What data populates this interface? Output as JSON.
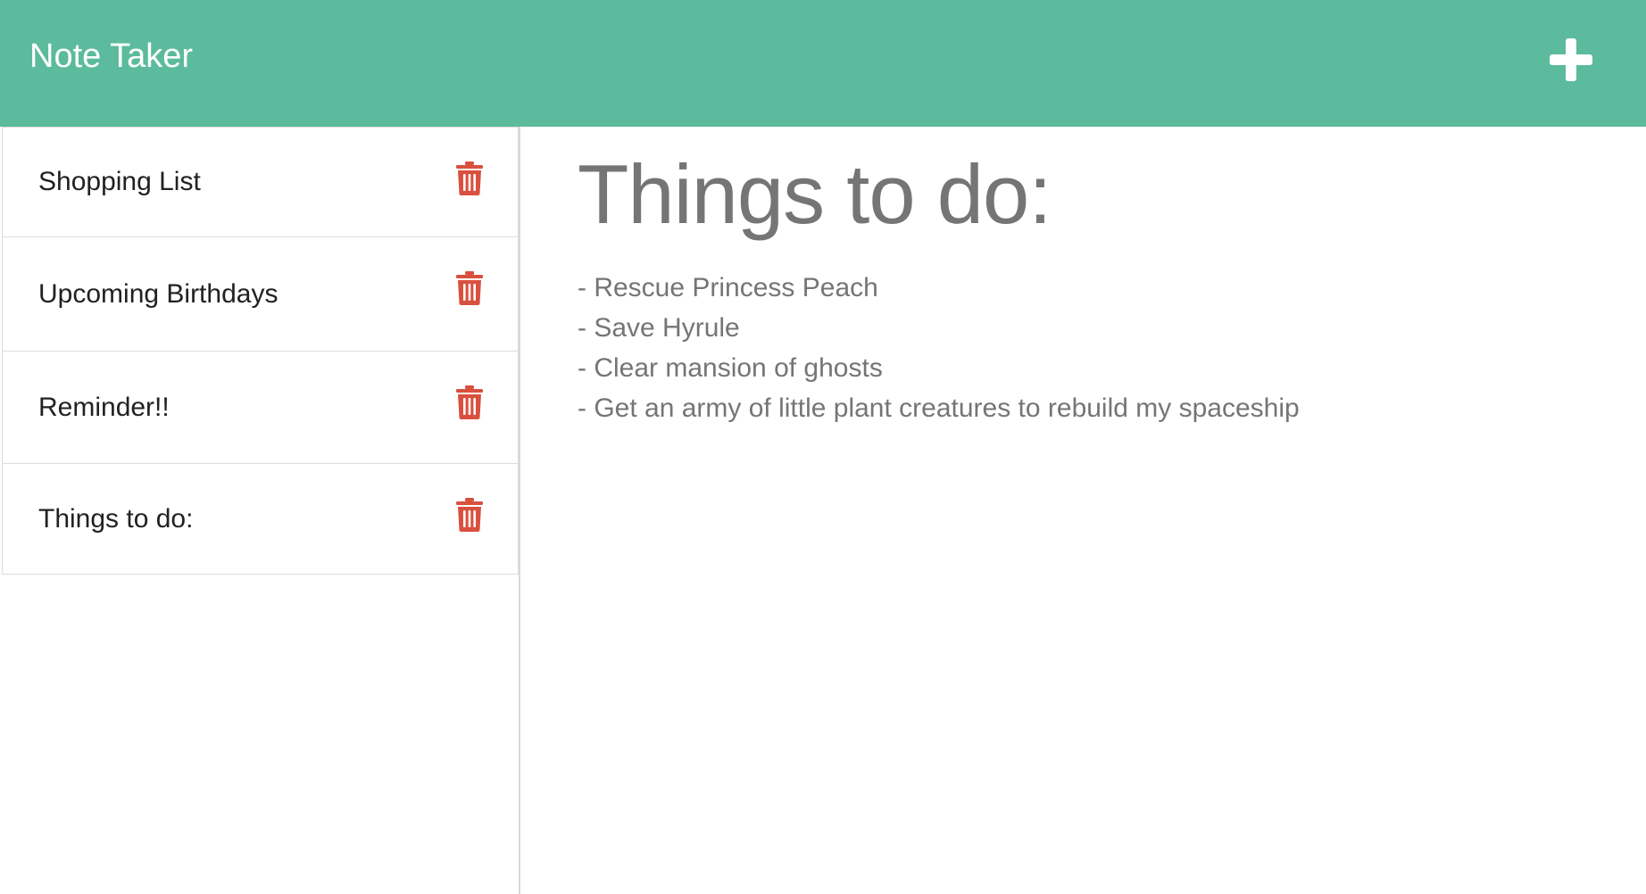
{
  "header": {
    "title": "Note Taker",
    "add_icon": "plus-icon",
    "background_color": "#5bbb9c"
  },
  "sidebar": {
    "notes": [
      {
        "title": "Shopping List",
        "delete_icon": "trash-icon"
      },
      {
        "title": "Upcoming Birthdays",
        "delete_icon": "trash-icon"
      },
      {
        "title": "Reminder!!",
        "delete_icon": "trash-icon"
      },
      {
        "title": "Things to do:",
        "delete_icon": "trash-icon"
      }
    ],
    "delete_color": "#d9503f"
  },
  "main": {
    "title": "Things to do:",
    "lines": [
      "- Rescue Princess Peach",
      "- Save Hyrule",
      "- Clear mansion of ghosts",
      "- Get an army of little plant creatures to rebuild my spaceship"
    ]
  }
}
